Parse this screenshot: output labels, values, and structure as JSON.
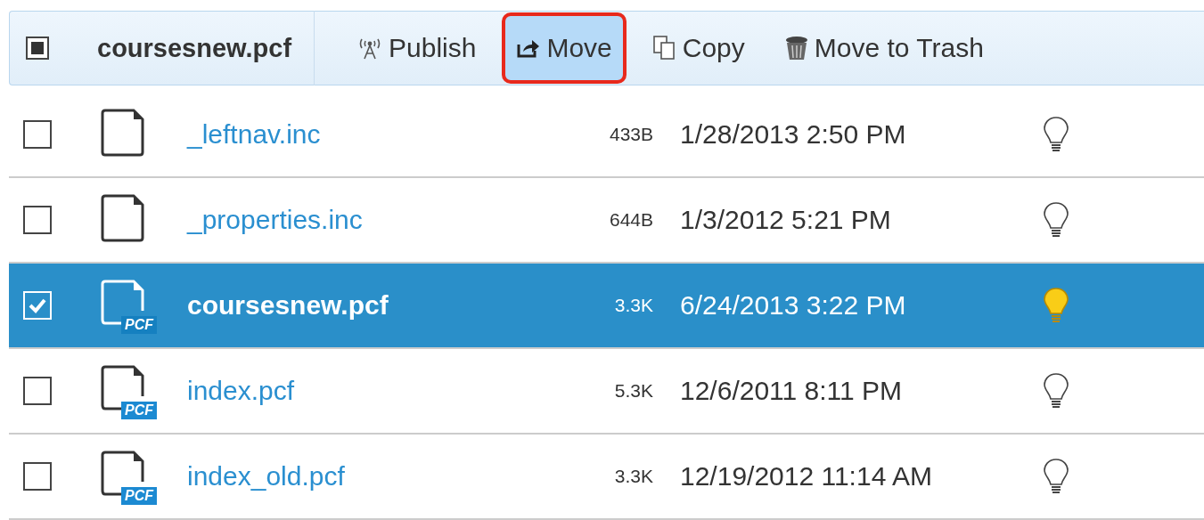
{
  "toolbar": {
    "select_all": {
      "indeterminate": true
    },
    "file_name": "coursesnew.pcf",
    "actions": [
      {
        "kind": "publish",
        "label": "Publish",
        "pressed": false,
        "highlighted": false
      },
      {
        "kind": "move",
        "label": "Move",
        "pressed": true,
        "highlighted": true
      },
      {
        "kind": "copy",
        "label": "Copy",
        "pressed": false,
        "highlighted": false
      },
      {
        "kind": "trash",
        "label": "Move to Trash",
        "pressed": false,
        "highlighted": false
      }
    ]
  },
  "files": [
    {
      "checked": false,
      "selected": false,
      "kind": "file",
      "name": "_leftnav.inc",
      "size": "433B",
      "modified": "1/28/2013 2:50 PM",
      "lit": false
    },
    {
      "checked": false,
      "selected": false,
      "kind": "file",
      "name": "_properties.inc",
      "size": "644B",
      "modified": "1/3/2012 5:21 PM",
      "lit": false
    },
    {
      "checked": true,
      "selected": true,
      "kind": "pcf",
      "badge": "PCF",
      "name": "coursesnew.pcf",
      "size": "3.3K",
      "modified": "6/24/2013 3:22 PM",
      "lit": true
    },
    {
      "checked": false,
      "selected": false,
      "kind": "pcf",
      "badge": "PCF",
      "name": "index.pcf",
      "size": "5.3K",
      "modified": "12/6/2011 8:11 PM",
      "lit": false
    },
    {
      "checked": false,
      "selected": false,
      "kind": "pcf",
      "badge": "PCF",
      "name": "index_old.pcf",
      "size": "3.3K",
      "modified": "12/19/2012 11:14 AM",
      "lit": false
    }
  ]
}
